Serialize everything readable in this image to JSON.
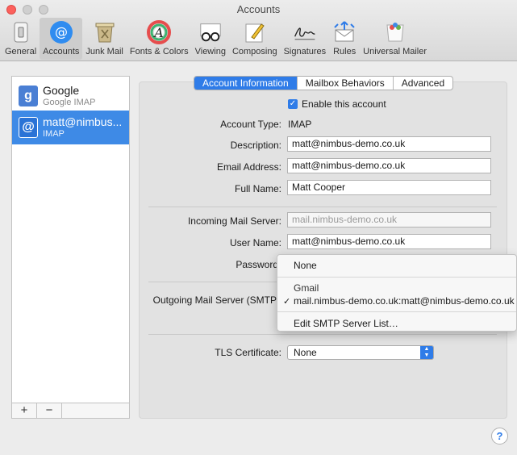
{
  "window": {
    "title": "Accounts"
  },
  "toolbar": {
    "items": [
      {
        "label": "General",
        "icon": "general-switch-icon"
      },
      {
        "label": "Accounts",
        "icon": "at-sign-icon"
      },
      {
        "label": "Junk Mail",
        "icon": "trash-icon"
      },
      {
        "label": "Fonts & Colors",
        "icon": "font-icon"
      },
      {
        "label": "Viewing",
        "icon": "glasses-icon"
      },
      {
        "label": "Composing",
        "icon": "pencil-icon"
      },
      {
        "label": "Signatures",
        "icon": "signature-icon"
      },
      {
        "label": "Rules",
        "icon": "rules-icon"
      },
      {
        "label": "Universal Mailer",
        "icon": "universal-mailer-icon"
      }
    ],
    "active": "Accounts"
  },
  "accounts": [
    {
      "name": "Google",
      "type": "Google IMAP",
      "glyph": "g",
      "color": "#4a7fd4"
    },
    {
      "name": "matt@nimbus...",
      "type": "IMAP",
      "glyph": "@",
      "color": "#3e8ae6"
    }
  ],
  "list_footer": {
    "add": "+",
    "remove": "−"
  },
  "tabs": [
    "Account Information",
    "Mailbox Behaviors",
    "Advanced"
  ],
  "form": {
    "enable_label": "Enable this account",
    "account_type_label": "Account Type:",
    "account_type_value": "IMAP",
    "description_label": "Description:",
    "description_value": "matt@nimbus-demo.co.uk",
    "email_label": "Email Address:",
    "email_value": "matt@nimbus-demo.co.uk",
    "fullname_label": "Full Name:",
    "fullname_value": "Matt Cooper",
    "incoming_label": "Incoming Mail Server:",
    "incoming_value": "mail.nimbus-demo.co.uk",
    "username_label": "User Name:",
    "username_value": "matt@nimbus-demo.co.uk",
    "password_label": "Password",
    "smtp_label": "Outgoing Mail Server (SMTP",
    "tls_label": "TLS Certificate:",
    "tls_value": "None"
  },
  "smtp_menu": {
    "none": "None",
    "group": "Gmail",
    "selected_item": "mail.nimbus-demo.co.uk:matt@nimbus-demo.co.uk",
    "check": "✓",
    "edit": "Edit SMTP Server List…"
  },
  "help": "?",
  "colors": {
    "accent": "#2f7ce8",
    "selection": "#3e8ae6",
    "close": "#fc605c"
  }
}
